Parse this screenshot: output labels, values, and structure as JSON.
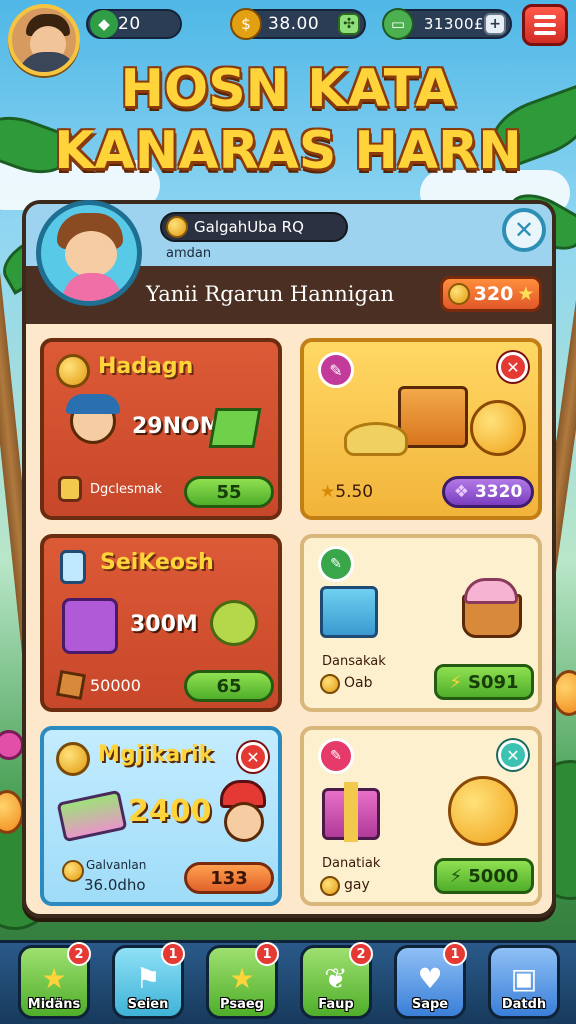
{
  "hud": {
    "gems": "20",
    "gold": "38.00",
    "cash": "31300£",
    "gold_plus": "✣",
    "cash_plus": "+"
  },
  "title": {
    "line1": "HOSN KATA",
    "line2": "KANARAS HARN"
  },
  "profile": {
    "name": "GalgahUba RQ",
    "subtitle": "amdan",
    "bar_text": "Yanii Rgarun Hannigan",
    "coins": "320"
  },
  "cards": [
    {
      "title": "Hadagn",
      "big": "29NOM",
      "small": "Dgclesmak",
      "button": "55",
      "style": "red"
    },
    {
      "price_left": "5.50",
      "button": "3320",
      "style": "yellow"
    },
    {
      "title": "SeiKeosh",
      "big": "300M",
      "small": "50000",
      "button": "65",
      "style": "red"
    },
    {
      "small1": "Dansakak",
      "small2": "Oab",
      "button": "S091",
      "style": "cream"
    },
    {
      "title": "Mgjikarik",
      "big": "2400",
      "small1": "Galvanlan",
      "small2": "36.0dho",
      "button": "133",
      "style": "blue"
    },
    {
      "small1": "Danatiak",
      "small2": "gay",
      "button": "5000",
      "style": "cream"
    }
  ],
  "nav": [
    {
      "label": "Midäns",
      "badge": "2",
      "color": "#5cc43a"
    },
    {
      "label": "Seien",
      "badge": "1",
      "color": "#3fb3d8"
    },
    {
      "label": "Psaeg",
      "badge": "1",
      "color": "#5cc43a"
    },
    {
      "label": "Faup",
      "badge": "2",
      "color": "#5cc43a"
    },
    {
      "label": "Sape",
      "badge": "1",
      "color": "#3a7fd8"
    },
    {
      "label": "Datdh",
      "badge": "",
      "color": "#3a7fd8"
    }
  ],
  "colors": {
    "accent_gold": "#ffd43b",
    "panel": "#fde8cc",
    "nav": "#1f4a74"
  },
  "icons": {
    "gem": "gem-icon",
    "gold": "gold-coin-icon",
    "cash": "cash-icon",
    "menu": "hamburger-menu-icon",
    "close": "close-icon",
    "star": "star-icon"
  }
}
